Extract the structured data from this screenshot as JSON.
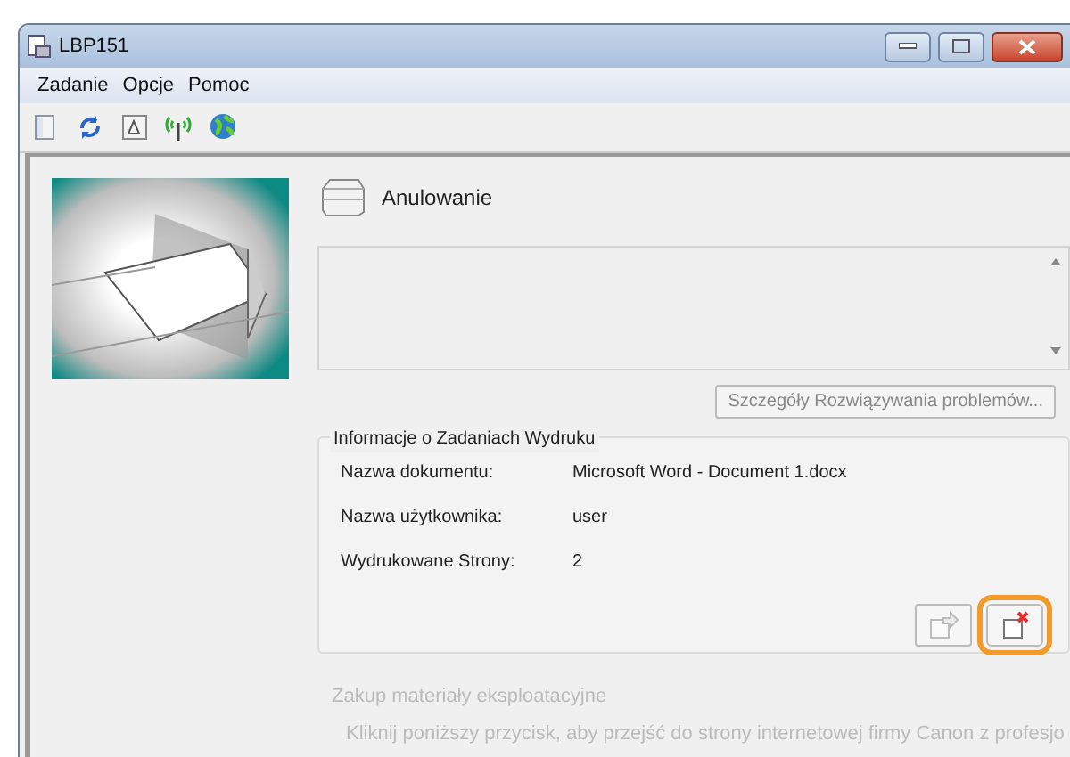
{
  "window": {
    "title": "LBP151"
  },
  "menu": [
    {
      "label": "Zadanie"
    },
    {
      "label": "Opcje"
    },
    {
      "label": "Pomoc"
    }
  ],
  "toolbar": [
    {
      "kind": "panel"
    },
    {
      "kind": "refresh"
    },
    {
      "kind": "tray"
    },
    {
      "kind": "antenna"
    },
    {
      "kind": "globe"
    }
  ],
  "status": {
    "title": "Anulowanie"
  },
  "details_button": {
    "label": "Szczegóły Rozwiązywania problemów...",
    "disabled": true
  },
  "job_info": {
    "title": "Informacje o Zadaniach Wydruku",
    "rows": [
      {
        "label": "Nazwa dokumentu:",
        "value": "Microsoft Word - Document 1.docx"
      },
      {
        "label": "Nazwa użytkownika:",
        "value": "user"
      },
      {
        "label": "Wydrukowane Strony:",
        "value": "2"
      }
    ],
    "actions": [
      {
        "kind": "resume",
        "disabled": true,
        "highlighted": false
      },
      {
        "kind": "cancel",
        "disabled": false,
        "highlighted": true
      }
    ]
  },
  "supplies": {
    "title": "Zakup materiały eksploatacyjne",
    "text": "Kliknij poniższy przycisk, aby przejść do strony internetowej firmy Canon z profesjo",
    "disabled": true
  }
}
